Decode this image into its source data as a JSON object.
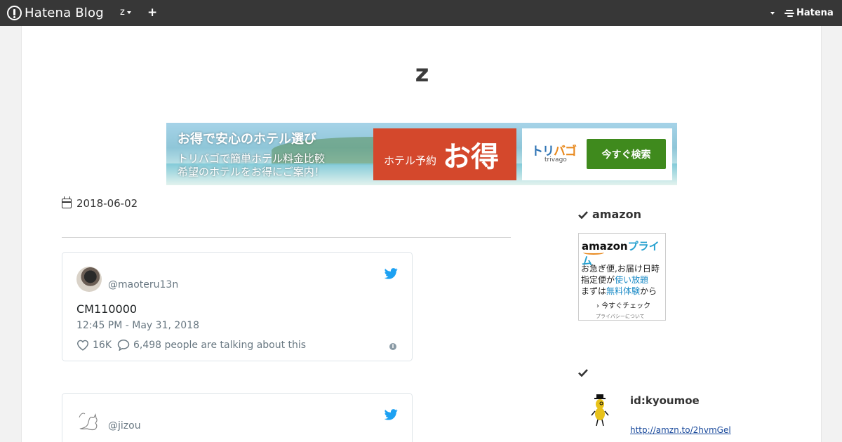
{
  "topbar": {
    "logo_text": "Hatena Blog",
    "blog_switch_label": "z",
    "add_label": "+",
    "brand_text": "Hatena"
  },
  "blog": {
    "title": "z"
  },
  "ad": {
    "headline": "お得で安心のホテル選び",
    "line1": "トリバゴで簡単ホテル料金比較",
    "line2": "希望のホテルをお得にご案内！",
    "red_small": "ホテル予約",
    "red_big": "お得",
    "trivago_logo_a": "トリ",
    "trivago_logo_b": "バゴ",
    "trivago_sub": "trivago",
    "cta": "今すぐ検索"
  },
  "entry": {
    "date": "2018-06-02"
  },
  "tweets": [
    {
      "handle": "@maoteru13n",
      "text": "CM110000",
      "time": "12:45 PM - May 31, 2018",
      "likes": "16K",
      "talking": "6,498 people are talking about this"
    },
    {
      "handle": "@jizou"
    }
  ],
  "sidebar": {
    "amazon_heading": "amazon",
    "amazon_ad": {
      "logo_a": "amazon",
      "logo_b": "プライム",
      "line1": "お急ぎ便,お届け日時",
      "line2_a": "指定便が",
      "line2_b": "使い放題",
      "line3_a": "まずは",
      "line3_b": "無料体験",
      "line3_c": "から",
      "check": "今すぐチェック",
      "privacy": "プライバシーについて"
    },
    "profile": {
      "id": "id:kyoumoe",
      "link": "http://amzn.to/2hvmGel"
    }
  },
  "colors": {
    "topbar": "#373737",
    "twitter_blue": "#1da1f2",
    "ad_red": "#d4482c",
    "ad_green": "#3f8a1d"
  },
  "icons": [
    "hatena-logo-icon",
    "caret-down-icon",
    "plus-icon",
    "hatena-brand-icon",
    "calendar-icon",
    "twitter-bird-icon",
    "heart-icon",
    "comment-icon",
    "info-icon",
    "check-icon",
    "peanut-mascot-icon"
  ]
}
